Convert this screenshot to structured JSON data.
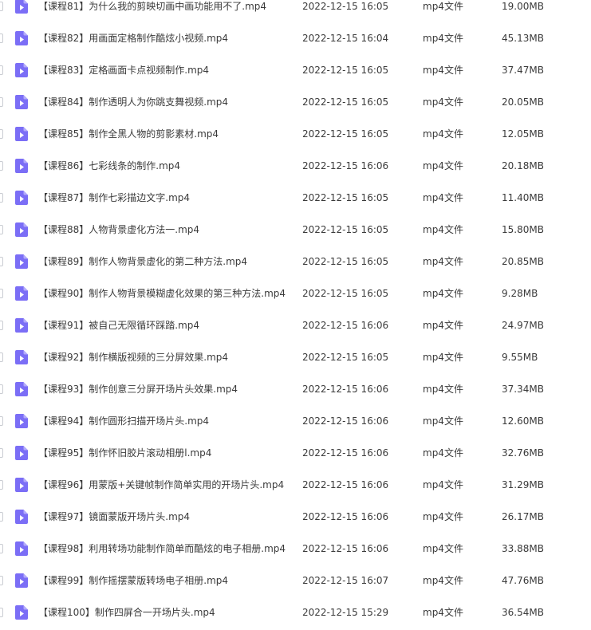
{
  "icons": {
    "file_icon": "video-file-icon",
    "file_icon_color": "#7b6ef6"
  },
  "files": [
    {
      "name": "【课程81】为什么我的剪映切画中画功能用不了.mp4",
      "date": "2022-12-15 16:05",
      "type": "mp4文件",
      "size": "19.00MB"
    },
    {
      "name": "【课程82】用画面定格制作酷炫小视频.mp4",
      "date": "2022-12-15 16:04",
      "type": "mp4文件",
      "size": "45.13MB"
    },
    {
      "name": "【课程83】定格画面卡点视频制作.mp4",
      "date": "2022-12-15 16:05",
      "type": "mp4文件",
      "size": "37.47MB"
    },
    {
      "name": "【课程84】制作透明人为你跳支舞视频.mp4",
      "date": "2022-12-15 16:05",
      "type": "mp4文件",
      "size": "20.05MB"
    },
    {
      "name": "【课程85】制作全黑人物的剪影素材.mp4",
      "date": "2022-12-15 16:05",
      "type": "mp4文件",
      "size": "12.05MB"
    },
    {
      "name": "【课程86】七彩线条的制作.mp4",
      "date": "2022-12-15 16:06",
      "type": "mp4文件",
      "size": "20.18MB"
    },
    {
      "name": "【课程87】制作七彩描边文字.mp4",
      "date": "2022-12-15 16:05",
      "type": "mp4文件",
      "size": "11.40MB"
    },
    {
      "name": "【课程88】人物背景虚化方法一.mp4",
      "date": "2022-12-15 16:05",
      "type": "mp4文件",
      "size": "15.80MB"
    },
    {
      "name": "【课程89】制作人物背景虚化的第二种方法.mp4",
      "date": "2022-12-15 16:05",
      "type": "mp4文件",
      "size": "20.85MB"
    },
    {
      "name": "【课程90】制作人物背景模糊虚化效果的第三种方法.mp4",
      "date": "2022-12-15 16:05",
      "type": "mp4文件",
      "size": "9.28MB"
    },
    {
      "name": "【课程91】被自己无限循环踩踏.mp4",
      "date": "2022-12-15 16:06",
      "type": "mp4文件",
      "size": "24.97MB"
    },
    {
      "name": "【课程92】制作横版视频的三分屏效果.mp4",
      "date": "2022-12-15 16:05",
      "type": "mp4文件",
      "size": "9.55MB"
    },
    {
      "name": "【课程93】制作创意三分屏开场片头效果.mp4",
      "date": "2022-12-15 16:06",
      "type": "mp4文件",
      "size": "37.34MB"
    },
    {
      "name": "【课程94】制作圆形扫描开场片头.mp4",
      "date": "2022-12-15 16:06",
      "type": "mp4文件",
      "size": "12.60MB"
    },
    {
      "name": "【课程95】制作怀旧胶片滚动相册l.mp4",
      "date": "2022-12-15 16:06",
      "type": "mp4文件",
      "size": "32.76MB"
    },
    {
      "name": "【课程96】用蒙版+关键帧制作简单实用的开场片头.mp4",
      "date": "2022-12-15 16:06",
      "type": "mp4文件",
      "size": "31.29MB"
    },
    {
      "name": "【课程97】镜面蒙版开场片头.mp4",
      "date": "2022-12-15 16:06",
      "type": "mp4文件",
      "size": "26.17MB"
    },
    {
      "name": "【课程98】利用转场功能制作简单而酷炫的电子相册.mp4",
      "date": "2022-12-15 16:06",
      "type": "mp4文件",
      "size": "33.88MB"
    },
    {
      "name": "【课程99】制作摇摆蒙版转场电子相册.mp4",
      "date": "2022-12-15 16:07",
      "type": "mp4文件",
      "size": "47.76MB"
    },
    {
      "name": "【课程100】制作四屏合一开场片头.mp4",
      "date": "2022-12-15 15:29",
      "type": "mp4文件",
      "size": "36.54MB"
    }
  ]
}
